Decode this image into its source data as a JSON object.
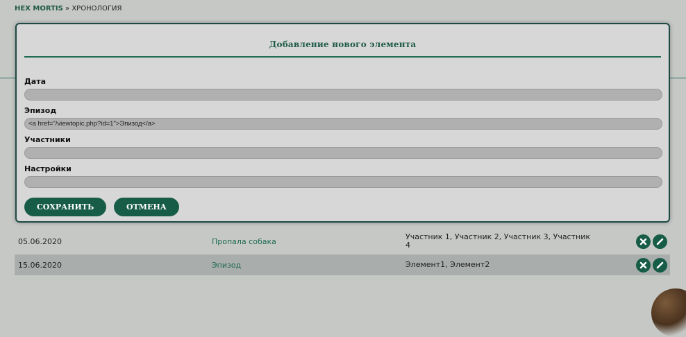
{
  "breadcrumb": {
    "home": "HEX MORTIS",
    "separator": " » ",
    "current": "ХРОНОЛОГИЯ"
  },
  "modal": {
    "title": "Добавление нового элемента",
    "fields": [
      {
        "label": "Дата",
        "value": "",
        "placeholder": ""
      },
      {
        "label": "Эпизод",
        "value": "<a href=\"/viewtopic.php?id=1\">Эпизод</a>",
        "placeholder": ""
      },
      {
        "label": "Участники",
        "value": "",
        "placeholder": ""
      },
      {
        "label": "Настройки",
        "value": "",
        "placeholder": ""
      }
    ],
    "save_label": "СОХРАНИТЬ",
    "cancel_label": "ОТМЕНА"
  },
  "table": {
    "rows": [
      {
        "date": "05.06.2020",
        "episode": "Пропала собака",
        "participants": "Участник 1, Участник 2, Участник 3, Участник 4"
      },
      {
        "date": "15.06.2020",
        "episode": "Эпизод",
        "participants": "Элемент1, Элемент2"
      }
    ]
  },
  "icons": {
    "delete": "close-icon",
    "edit": "pencil-icon"
  },
  "colors": {
    "accent": "#175c46",
    "background": "#c6c8c6",
    "modal_bg": "#d7d7d7"
  }
}
